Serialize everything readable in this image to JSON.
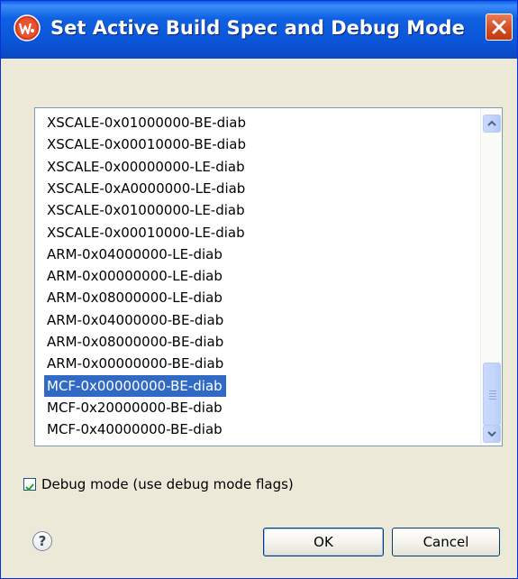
{
  "window": {
    "title": "Set Active Build Spec and Debug Mode",
    "app_icon": "wind-river-w-icon"
  },
  "build_specs": {
    "items": [
      "XSCALE-0x01000000-BE-diab",
      "XSCALE-0x00010000-BE-diab",
      "XSCALE-0x00000000-LE-diab",
      "XSCALE-0xA0000000-LE-diab",
      "XSCALE-0x01000000-LE-diab",
      "XSCALE-0x00010000-LE-diab",
      "ARM-0x04000000-LE-diab",
      "ARM-0x00000000-LE-diab",
      "ARM-0x08000000-LE-diab",
      "ARM-0x04000000-BE-diab",
      "ARM-0x08000000-BE-diab",
      "ARM-0x00000000-BE-diab",
      "MCF-0x00000000-BE-diab",
      "MCF-0x20000000-BE-diab",
      "MCF-0x40000000-BE-diab"
    ],
    "selected_index": 12
  },
  "debug_mode": {
    "label": "Debug mode (use debug mode flags)",
    "checked": true
  },
  "buttons": {
    "help": "?",
    "ok": "OK",
    "cancel": "Cancel"
  },
  "colors": {
    "title_bar": "#0b55d8",
    "selection": "#316ac5",
    "dialog_bg": "#ece9d8",
    "checkmark": "#21a121"
  }
}
